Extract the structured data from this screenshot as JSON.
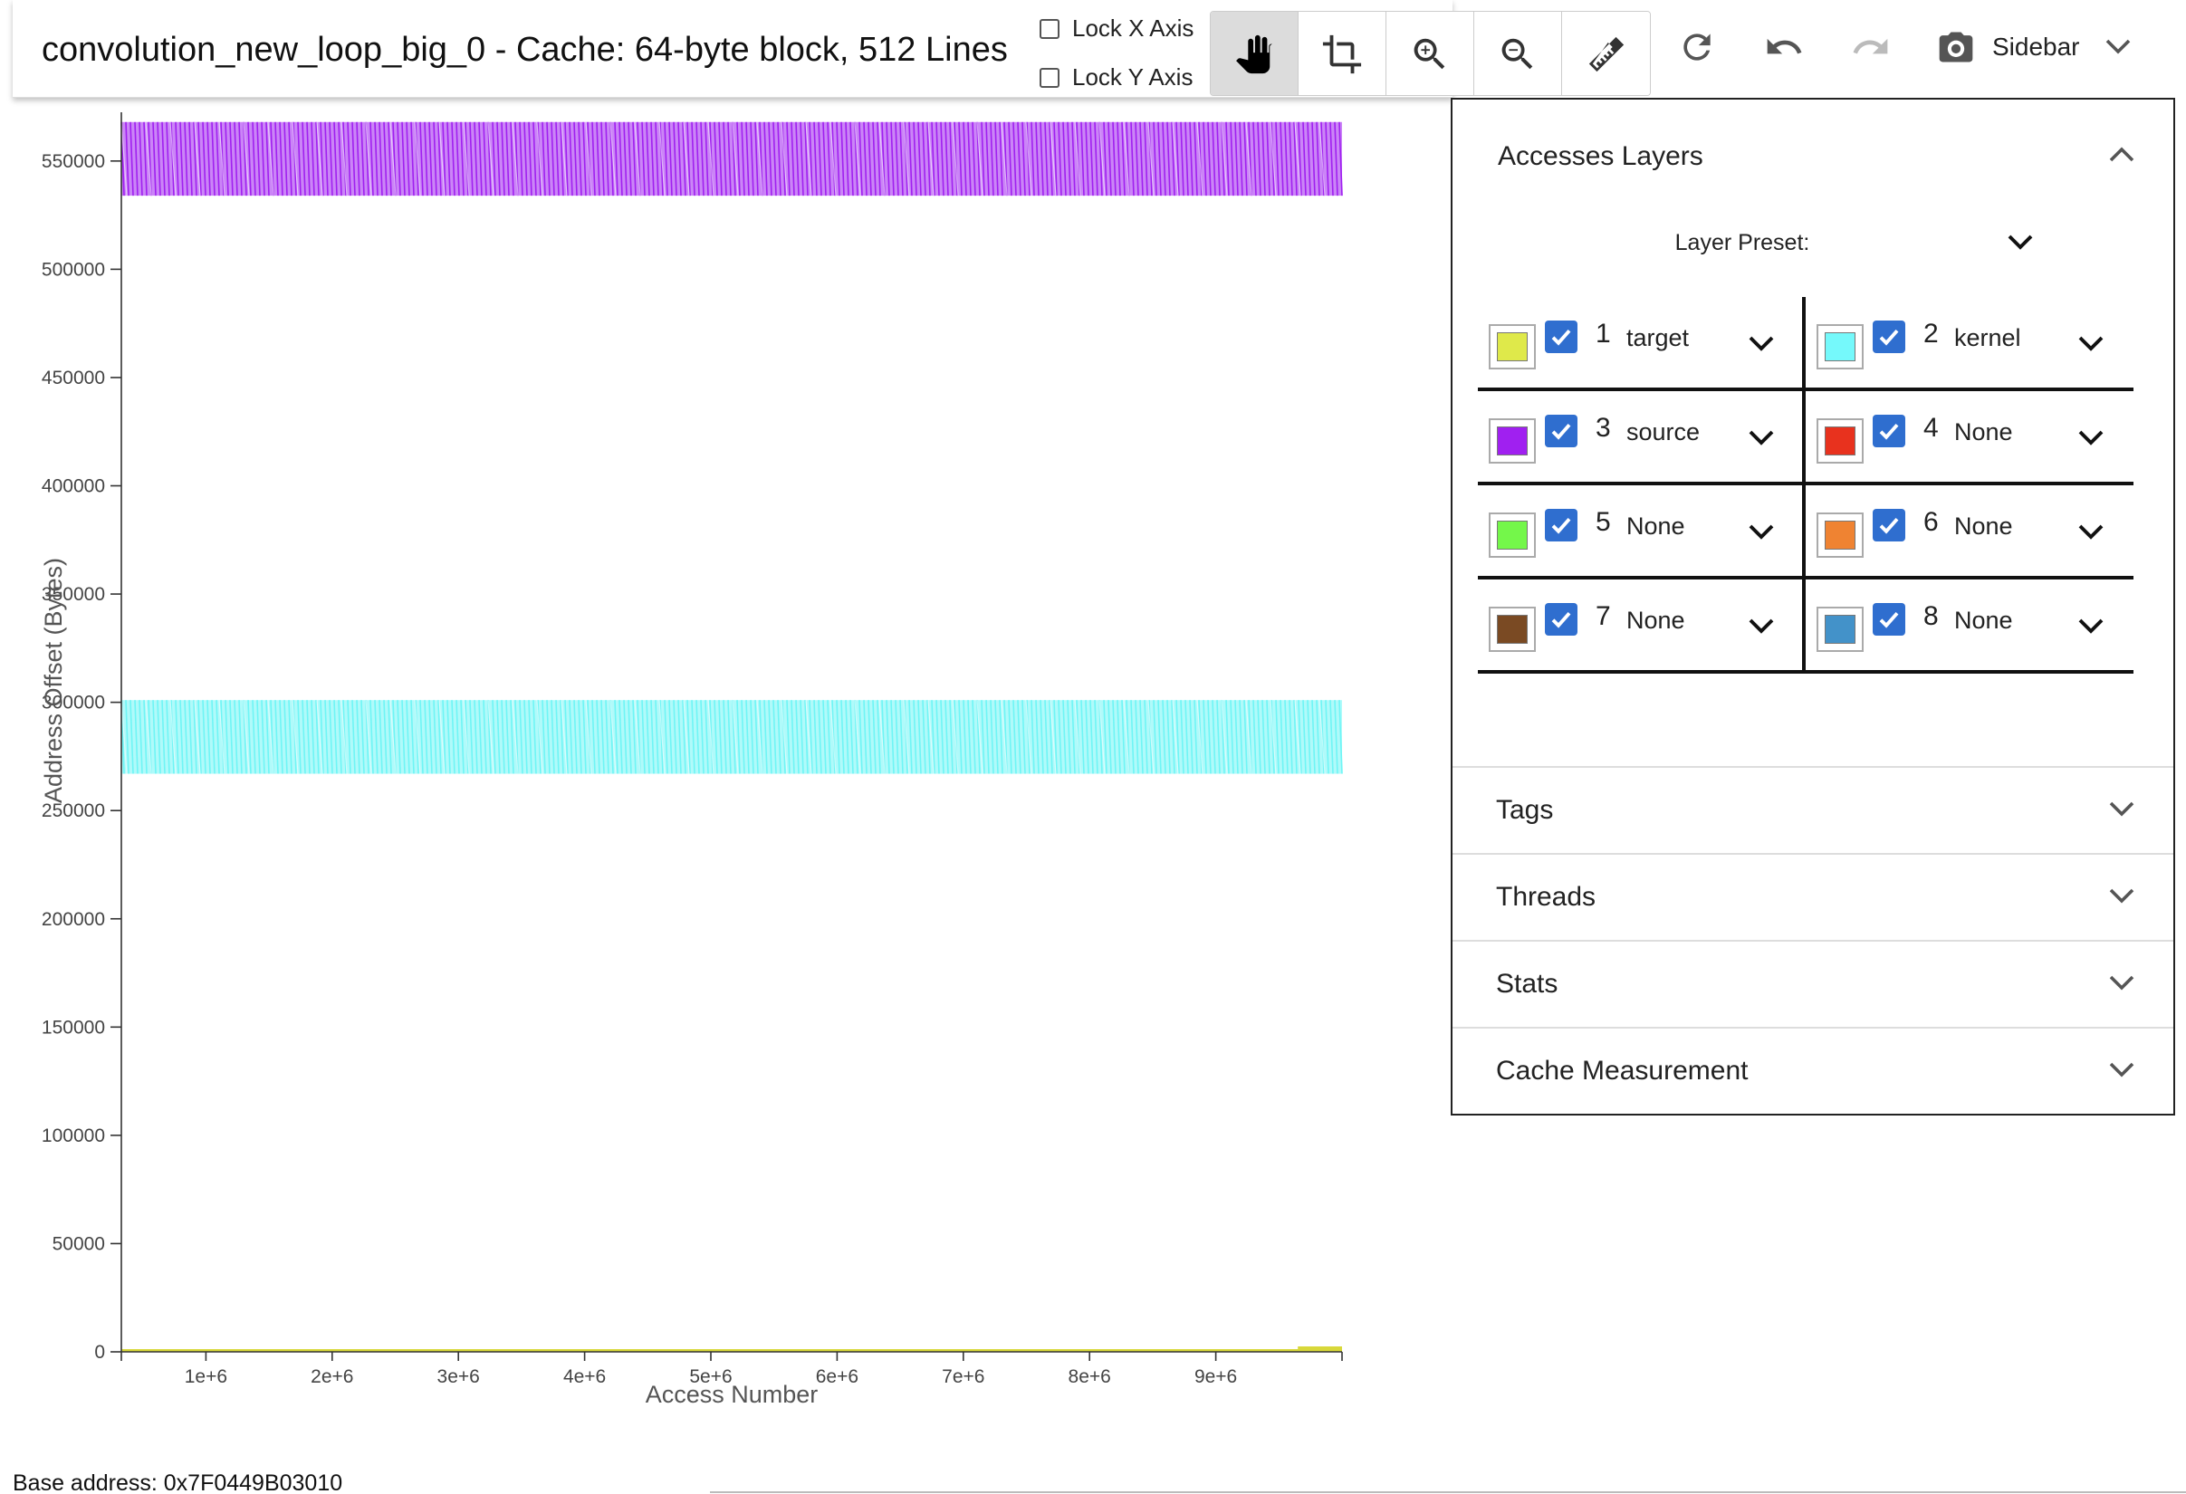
{
  "header": {
    "title": "convolution_new_loop_big_0 - Cache: 64-byte block, 512 Lines",
    "lock_x_label": "Lock X Axis",
    "lock_y_label": "Lock Y Axis",
    "lock_x_checked": false,
    "lock_y_checked": false,
    "tools": [
      {
        "icon": "hand-pan-icon",
        "active": true
      },
      {
        "icon": "crop-icon",
        "active": false
      },
      {
        "icon": "zoom-in-icon",
        "active": false
      },
      {
        "icon": "zoom-out-icon",
        "active": false
      },
      {
        "icon": "ruler-icon",
        "active": false
      }
    ],
    "actions": [
      "refresh-icon",
      "undo-icon",
      "redo-icon"
    ],
    "sidebar_label": "Sidebar"
  },
  "chart_data": {
    "type": "scatter",
    "xlabel": "Access Number",
    "ylabel": "Address Offset (Bytes)",
    "xlim": [
      330000,
      10000000
    ],
    "ylim": [
      0,
      570000
    ],
    "x_ticks": [
      1000000,
      2000000,
      3000000,
      4000000,
      5000000,
      6000000,
      7000000,
      8000000,
      9000000
    ],
    "x_tick_labels": [
      "1e+6",
      "2e+6",
      "3e+6",
      "4e+6",
      "5e+6",
      "6e+6",
      "7e+6",
      "8e+6",
      "9e+6"
    ],
    "y_ticks": [
      0,
      50000,
      100000,
      150000,
      200000,
      250000,
      300000,
      350000,
      400000,
      450000,
      500000,
      550000
    ],
    "y_tick_labels": [
      "0",
      "50000",
      "100000",
      "150000",
      "200000",
      "250000",
      "300000",
      "350000",
      "400000",
      "450000",
      "500000",
      "550000"
    ],
    "series": [
      {
        "name": "source",
        "color": "#a020f0",
        "x_range": [
          330000,
          10000000
        ],
        "y_range": [
          534000,
          568000
        ]
      },
      {
        "name": "kernel",
        "color": "#6ff5f5",
        "x_range": [
          330000,
          10000000
        ],
        "y_range": [
          267000,
          301000
        ]
      },
      {
        "name": "target",
        "color": "#d8d83a",
        "x_range": [
          330000,
          10000000
        ],
        "y_range": [
          0,
          1500
        ]
      }
    ]
  },
  "footer": {
    "base_address": "Base address: 0x7F0449B03010"
  },
  "sidebar": {
    "accesses_title": "Accesses Layers",
    "layer_preset_label": "Layer Preset:",
    "layers": [
      {
        "num": "1",
        "name": "target",
        "color": "#dfe94a",
        "checked": true
      },
      {
        "num": "2",
        "name": "kernel",
        "color": "#75f9fb",
        "checked": true
      },
      {
        "num": "3",
        "name": "source",
        "color": "#a020f0",
        "checked": true
      },
      {
        "num": "4",
        "name": "None",
        "color": "#e8321e",
        "checked": true
      },
      {
        "num": "5",
        "name": "None",
        "color": "#74f74a",
        "checked": true
      },
      {
        "num": "6",
        "name": "None",
        "color": "#ef8332",
        "checked": true
      },
      {
        "num": "7",
        "name": "None",
        "color": "#7a4a23",
        "checked": true
      },
      {
        "num": "8",
        "name": "None",
        "color": "#4392c9",
        "checked": true
      }
    ],
    "sections": [
      "Tags",
      "Threads",
      "Stats",
      "Cache Measurement"
    ]
  }
}
